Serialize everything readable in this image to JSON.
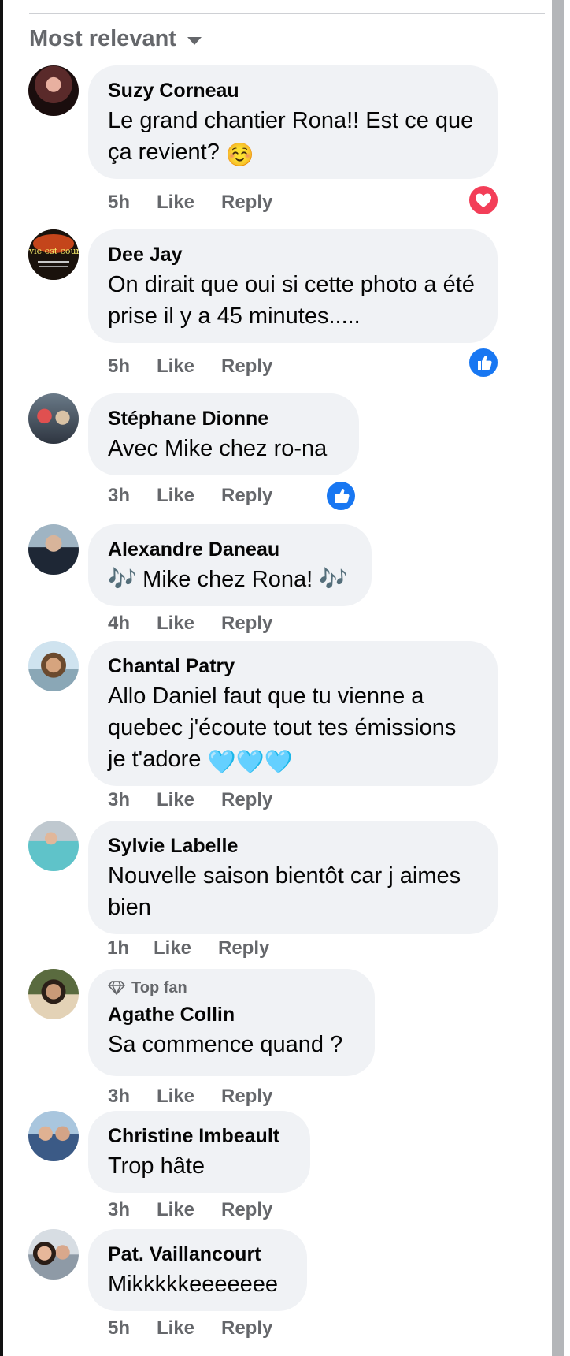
{
  "sort": {
    "label": "Most relevant"
  },
  "comments": [
    {
      "name": "Suzy Corneau",
      "text": "Le grand chantier Rona!! Est ce que ça revient?",
      "emoji": "☺️",
      "time": "5h",
      "like": "Like",
      "reply": "Reply",
      "reaction": "love"
    },
    {
      "name": "Dee Jay",
      "avatar_text": "la vie est courte",
      "text": "On dirait que oui si cette photo a été prise il y a 45 minutes.....",
      "time": "5h",
      "like": "Like",
      "reply": "Reply",
      "reaction": "like"
    },
    {
      "name": "Stéphane Dionne",
      "text": "Avec Mike chez ro-na",
      "time": "3h",
      "like": "Like",
      "reply": "Reply",
      "reaction": "like"
    },
    {
      "name": "Alexandre Daneau",
      "text": "🎶 Mike chez Rona! 🎶",
      "time": "4h",
      "like": "Like",
      "reply": "Reply"
    },
    {
      "name": "Chantal Patry",
      "text": "Allo Daniel faut que tu vienne a quebec j'écoute tout tes émissions je t'adore",
      "emoji": "🩵🩵🩵",
      "time": "3h",
      "like": "Like",
      "reply": "Reply"
    },
    {
      "name": "Sylvie Labelle",
      "text": "Nouvelle saison bientôt car j aimes bien",
      "time": "1h",
      "like": "Like",
      "reply": "Reply"
    },
    {
      "badge": "Top fan",
      "name": "Agathe Collin",
      "text": "Sa commence quand ?",
      "time": "3h",
      "like": "Like",
      "reply": "Reply"
    },
    {
      "name": "Christine Imbeault",
      "text": "Trop hâte",
      "time": "3h",
      "like": "Like",
      "reply": "Reply"
    },
    {
      "name": "Pat. Vaillancourt",
      "text": "Mikkkkkeeeeeee",
      "time": "5h",
      "like": "Like",
      "reply": "Reply"
    }
  ],
  "colors": {
    "bubble": "#f0f2f5",
    "meta": "#65676b",
    "love": "#f33e58",
    "like": "#1877f2"
  }
}
